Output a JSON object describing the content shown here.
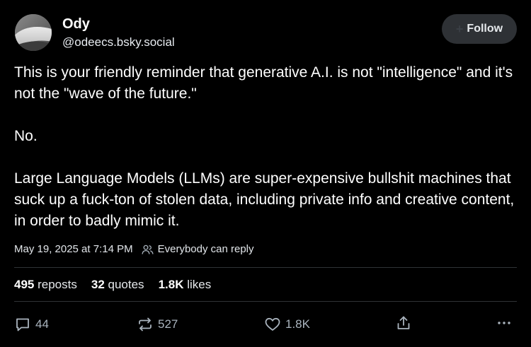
{
  "author": {
    "display_name": "Ody",
    "handle": "@odeecs.bsky.social",
    "avatar_icon": "avatar-photo"
  },
  "follow_button": {
    "label": "Follow",
    "icon": "plus-icon"
  },
  "post": {
    "paragraphs": [
      "This is your friendly reminder that generative A.I. is not \"intelligence\" and it's not the \"wave of the future.\"",
      "No.",
      "Large Language Models (LLMs) are super-expensive bullshit machines that suck up a fuck-ton of stolen data, including private info and creative content, in order to badly mimic it."
    ],
    "timestamp": "May 19, 2025 at 7:14 PM",
    "reply_setting": "Everybody can reply"
  },
  "stats": {
    "reposts_count": "495",
    "reposts_label": "reposts",
    "quotes_count": "32",
    "quotes_label": "quotes",
    "likes_count": "1.8K",
    "likes_label": "likes"
  },
  "actions": {
    "reply_count": "44",
    "repost_count": "527",
    "like_count": "1.8K"
  },
  "colors": {
    "background": "#000000",
    "text": "#ffffff",
    "muted": "#aab4be",
    "divider": "#2f3336",
    "follow_bg": "#2e3135"
  }
}
